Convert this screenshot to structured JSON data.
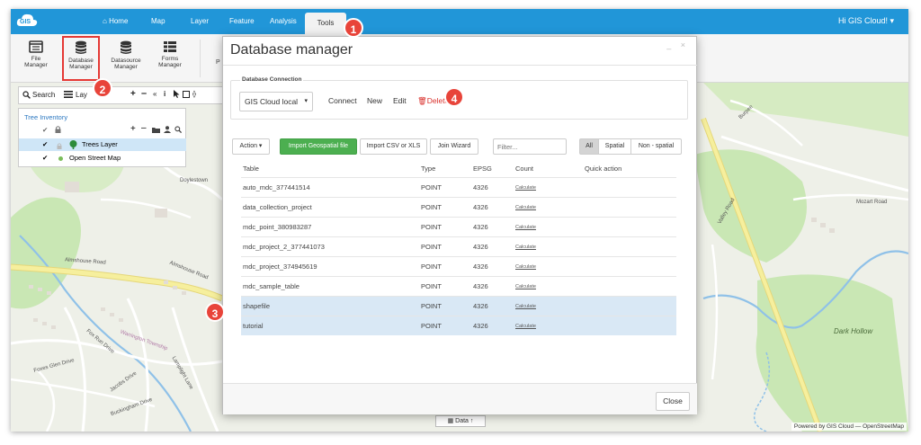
{
  "topnav": {
    "logo_text": "GIS",
    "tabs": [
      {
        "label": "Home"
      },
      {
        "label": "Map"
      },
      {
        "label": "Layer"
      },
      {
        "label": "Feature"
      },
      {
        "label": "Analysis"
      },
      {
        "label": "Tools"
      }
    ],
    "user_menu": "Hi GIS Cloud! ▾"
  },
  "ribbon": {
    "buttons": [
      {
        "line1": "File",
        "line2": "Manager"
      },
      {
        "line1": "Database",
        "line2": "Manager"
      },
      {
        "line1": "Datasource",
        "line2": "Manager"
      },
      {
        "line1": "Forms",
        "line2": "Manager"
      }
    ],
    "cut_label": "P"
  },
  "map_toolbar": {
    "search_label": "Search",
    "layers_label": "Lay"
  },
  "tree_panel": {
    "title": "Tree Inventory",
    "layers": [
      {
        "label": "Trees Layer",
        "selected": true
      },
      {
        "label": "Open Street Map",
        "selected": false
      }
    ]
  },
  "map": {
    "labels": [
      "Doylestown",
      "Almshouse Road",
      "Almshouse Road",
      "Dark Hollow",
      "Mozart Road",
      "Warrington Township",
      "Fox Run Drive",
      "Foxes Glen Drive",
      "Jacobs Drive",
      "Lamplight Lane",
      "Buckingham Drive",
      "Valley Road",
      "Burpee"
    ],
    "attribution": "Powered by GIS Cloud — OpenStreetMap",
    "data_bar_label": "Data",
    "colors": {
      "land": "#eef0e8",
      "park": "#c9e7b4",
      "water": "#8fc1e8",
      "road_major": "#f6ef9d",
      "road_minor": "#ffffff"
    }
  },
  "modal": {
    "title": "Database manager",
    "controls": "_ ×",
    "connection": {
      "legend": "Database Connection",
      "selected_db": "GIS Cloud local",
      "connect": "Connect",
      "new": "New",
      "edit": "Edit",
      "delete": "Delete"
    },
    "toolbar": {
      "action": "Action ▾",
      "import_geo": "Import Geospatial file",
      "import_csv": "Import CSV or XLS",
      "join_wizard": "Join Wizard",
      "filter_placeholder": "Filter...",
      "seg_all": "All",
      "seg_spatial": "Spatial",
      "seg_nonspatial": "Non - spatial"
    },
    "table": {
      "headers": {
        "table": "Table",
        "type": "Type",
        "epsg": "EPSG",
        "count": "Count",
        "quick": "Quick action"
      },
      "rows": [
        {
          "name": "auto_mdc_377441514",
          "type": "POINT",
          "epsg": "4326",
          "count": "Calculate",
          "selected": false
        },
        {
          "name": "data_collection_project",
          "type": "POINT",
          "epsg": "4326",
          "count": "Calculate",
          "selected": false
        },
        {
          "name": "mdc_point_380983287",
          "type": "POINT",
          "epsg": "4326",
          "count": "Calculate",
          "selected": false
        },
        {
          "name": "mdc_project_2_377441073",
          "type": "POINT",
          "epsg": "4326",
          "count": "Calculate",
          "selected": false
        },
        {
          "name": "mdc_project_374945619",
          "type": "POINT",
          "epsg": "4326",
          "count": "Calculate",
          "selected": false
        },
        {
          "name": "mdc_sample_table",
          "type": "POINT",
          "epsg": "4326",
          "count": "Calculate",
          "selected": false
        },
        {
          "name": "shapefile",
          "type": "POINT",
          "epsg": "4326",
          "count": "Calculate",
          "selected": true
        },
        {
          "name": "tutorial",
          "type": "POINT",
          "epsg": "4326",
          "count": "Calculate",
          "selected": true
        }
      ]
    },
    "close": "Close"
  },
  "annotations": {
    "badges": [
      "1",
      "2",
      "3",
      "4"
    ],
    "color": "#e8443a"
  }
}
